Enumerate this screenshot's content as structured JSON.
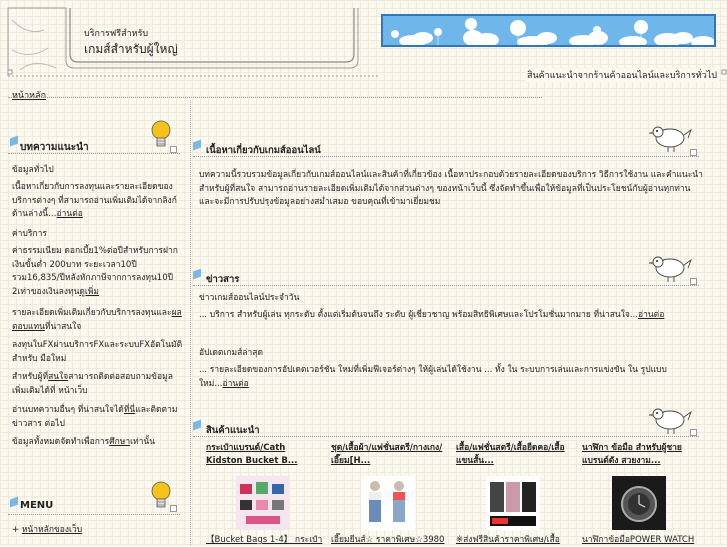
{
  "header": {
    "site_subtitle": "บริการฟรีสำหรับ",
    "site_title": "เกมส์สำหรับผู้ใหญ่",
    "tagline": "สินค้าแนะนำจากร้านค้าออนไลน์และบริการทั่วไป",
    "top_link": "หน้าหลัก"
  },
  "sidebar": {
    "section1": {
      "heading": "บทความแนะนำ",
      "sub1": "ข้อมูลทั่วไป",
      "para1": "เนื้อหาเกี่ยวกับการลงทุนและรายละเอียดของบริการต่างๆ ที่สามารถอ่านเพิ่มเติมได้จากลิงก์ด้านล่างนี้",
      "para1_more": "อ่านต่อ",
      "sub2": "ค่าบริการ",
      "para2": "ค่าธรรมเนียม ดอกเบี้ย1%ต่อปีสำหรับการฝากเงินขั้นต่ำ 200บาท ระยะเวลา10ปี รวม16,835/ปีหลังหักภาษีจากการลงทุน10ปี 2เท่าของเงินลงทุน",
      "para2_more": "ดูเพิ่ม",
      "para3_pre": "รายละเอียดเพิ่มเติมเกี่ยวกับบริการลงทุนและ",
      "para3_link": "ผลตอบแทน",
      "para3_post": "ที่น่าสนใจ",
      "para4": "ลงทุนในFXผ่านบริการFXและระบบFXอัตโนมัติสำหรับ มือใหม่",
      "para5_pre": "สำหรับผู้ที่",
      "para5_link": "สนใจ",
      "para5_post": "สามารถติดต่อสอบถามข้อมูลเพิ่มเติมได้ที่ หน้าเว็บ",
      "para6_pre": "อ่านบทความอื่นๆ ที่น่าสนใจได้",
      "para6_link": "ที่นี่",
      "para6_post": "และติดตามข่าวสาร ต่อไป",
      "para7_pre": "ข้อมูลทั้งหมดจัดทำเพื่อการ",
      "para7_link": "ศึกษา",
      "para7_post": "เท่านั้น"
    },
    "menu": {
      "heading": "MENU",
      "item1": "หน้าหลักของเว็บ"
    }
  },
  "main": {
    "intro_heading": "เนื้อหาเกี่ยวกับเกมส์ออนไลน์",
    "intro_text": "บทความนี้รวบรวมข้อมูลเกี่ยวกับเกมส์ออนไลน์และสินค้าที่เกี่ยวข้อง เนื้อหาประกอบด้วยรายละเอียดของบริการ วิธีการใช้งาน และคำแนะนำสำหรับผู้ที่สนใจ สามารถอ่านรายละเอียดเพิ่มเติมได้จากส่วนต่างๆ ของหน้าเว็บนี้ ซึ่งจัดทำขึ้นเพื่อให้ข้อมูลที่เป็นประโยชน์กับผู้อ่านทุกท่าน และจะมีการปรับปรุงข้อมูลอย่างสม่ำเสมอ ขอบคุณที่เข้ามาเยี่ยมชม",
    "news_heading": "ข่าวสาร",
    "news1_title": "ข่าวเกมส์ออนไลน์ประจำวัน",
    "news1_text": "... บริการ สำหรับผู้เล่น ทุกระดับ ตั้งแต่เริ่มต้นจนถึง ระดับ ผู้เชี่ยวชาญ พร้อมสิทธิพิเศษและโปรโมชั่นมากมาย ที่น่าสนใจ...",
    "news1_more": "อ่านต่อ",
    "news2_title": "อัปเดตเกมส์ล่าสุด",
    "news2_text": "... รายละเอียดของการอัปเดตเวอร์ชัน ใหม่ที่เพิ่มฟีเจอร์ต่างๆ ให้ผู้เล่นได้ใช้งาน ... ทั้ง ใน ระบบการเล่นและการแข่งขัน ใน รูปแบบใหม่...",
    "news2_more": "อ่านต่อ",
    "products_heading": "สินค้าแนะนำ",
    "products": [
      {
        "title": "กระเป๋าแบรนด์/Cath Kidston Bucket B...",
        "caption": "【Bucket Bags 1-4】 กระเป๋า"
      },
      {
        "title": "ชุด/เสื้อผ้า/แฟชั่นสตรี/กางเกง/เอี๊ยม[H...",
        "caption": "เอี๊ยมยีนส์☆ ราคาพิเศษ☆3980"
      },
      {
        "title": "เสื้อ/แฟชั่นสตรี/เสื้อยืดคอ/เสื้อแขนสั้น...",
        "caption": "※ส่งฟรีสินค้าราคาพิเศษ/เสื้อ"
      },
      {
        "title": "นาฬิกา ข้อมือ สำหรับผู้ชาย แบรนด์ดัง สวยงาม...",
        "caption": "นาฬิกาข้อมือPOWER WATCH"
      }
    ]
  },
  "colors": {
    "sky": "#6fb7ea",
    "sky_border": "#2f78b9",
    "background": "#fbf9ef",
    "bulb": "#f6c21a"
  }
}
